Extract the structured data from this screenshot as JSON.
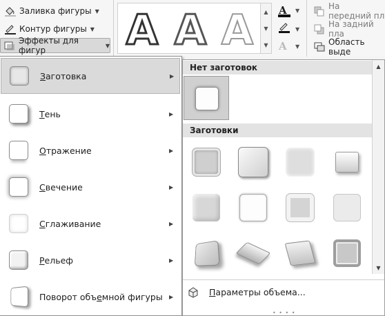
{
  "ribbon": {
    "fill_label": "Заливка фигуры",
    "outline_label": "Контур фигуры",
    "effects_label": "Эффекты для фигур",
    "bring_forward_label": "На передний пл",
    "send_backward_label": "На задний пла",
    "selection_pane_label": "Область выде",
    "wordart_letter": "A",
    "gallery_letters": [
      "A",
      "A",
      "A"
    ]
  },
  "menu": {
    "items": [
      {
        "accel": "З",
        "rest": "аготовка"
      },
      {
        "accel": "Т",
        "rest": "ень"
      },
      {
        "accel": "О",
        "rest": "тражение"
      },
      {
        "accel": "С",
        "rest": "вечение"
      },
      {
        "accel": "С",
        "rest": "глаживание"
      },
      {
        "accel": "Р",
        "rest": "ельеф"
      },
      {
        "pre": "Поворот объ",
        "accel": "е",
        "rest": "мной фигуры"
      }
    ]
  },
  "panel": {
    "no_preset_header": "Нет заготовок",
    "presets_header": "Заготовки",
    "footer_accel": "П",
    "footer_rest": "араметры объема..."
  }
}
